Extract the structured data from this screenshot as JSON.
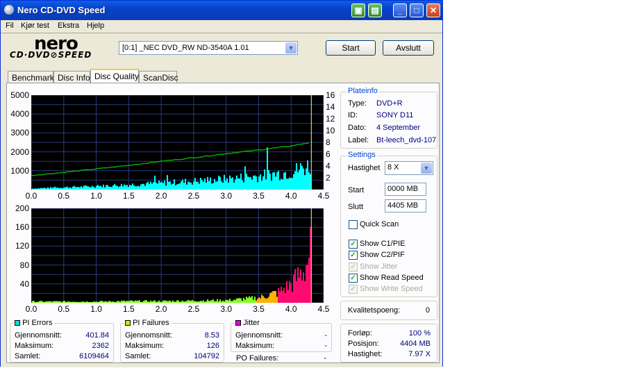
{
  "window": {
    "title": "Nero CD-DVD Speed"
  },
  "menu": [
    "Fil",
    "Kjør test",
    "Ekstra",
    "Hjelp"
  ],
  "logo": {
    "brand": "nero",
    "product": "CD·DVD⊘SPEED"
  },
  "drive": {
    "selected": "[0:1]  _NEC DVD_RW ND-3540A 1.01"
  },
  "buttons": {
    "start": "Start",
    "exit": "Avslutt"
  },
  "tabs": [
    "Benchmark",
    "Disc Info",
    "Disc Quality",
    "ScanDisc"
  ],
  "active_tab": "Disc Quality",
  "plateinfo": {
    "title": "Plateinfo",
    "rows": [
      {
        "label": "Type:",
        "value": "DVD+R"
      },
      {
        "label": "ID:",
        "value": "SONY D11"
      },
      {
        "label": "Dato:",
        "value": "4 September"
      },
      {
        "label": "Label:",
        "value": "Bt-leech_dvd-107"
      }
    ]
  },
  "settings": {
    "title": "Settings",
    "speed_label": "Hastighet",
    "speed_value": "8 X",
    "start_label": "Start",
    "start_value": "0000 MB",
    "end_label": "Slutt",
    "end_value": "4405 MB",
    "checks": [
      {
        "label": "Quick Scan",
        "checked": false,
        "enabled": true
      },
      {
        "label": "Show C1/PIE",
        "checked": true,
        "enabled": true
      },
      {
        "label": "Show C2/PIF",
        "checked": true,
        "enabled": true
      },
      {
        "label": "Show Jitter",
        "checked": true,
        "enabled": false
      },
      {
        "label": "Show Read Speed",
        "checked": true,
        "enabled": true
      },
      {
        "label": "Show Write Speed",
        "checked": true,
        "enabled": false
      }
    ]
  },
  "quality": {
    "label": "Kvalitetspoeng:",
    "value": "0"
  },
  "progress": {
    "rows": [
      {
        "label": "Forløp:",
        "value": "100 %"
      },
      {
        "label": "Posisjon:",
        "value": "4404 MB"
      },
      {
        "label": "Hastighet:",
        "value": "7.97 X"
      }
    ]
  },
  "pi_errors": {
    "title": "PI Errors",
    "color": "#00e0e0",
    "rows": [
      {
        "label": "Gjennomsnitt:",
        "value": "401.84"
      },
      {
        "label": "Maksimum:",
        "value": "2362"
      },
      {
        "label": "Samlet:",
        "value": "6109464"
      }
    ]
  },
  "pi_failures": {
    "title": "PI Failures",
    "color": "#e0e000",
    "rows": [
      {
        "label": "Gjennomsnitt:",
        "value": "8.53"
      },
      {
        "label": "Maksimum:",
        "value": "126"
      },
      {
        "label": "Samlet:",
        "value": "104792"
      }
    ]
  },
  "jitter": {
    "title": "Jitter",
    "color": "#e000e0",
    "rows": [
      {
        "label": "Gjennomsnitt:",
        "value": "-"
      },
      {
        "label": "Maksimum:",
        "value": "-"
      }
    ],
    "po_label": "PO Failures:",
    "po_value": "-"
  },
  "chart_data": [
    {
      "type": "area",
      "series": [
        {
          "name": "PI Errors",
          "color": "#00ffff"
        },
        {
          "name": "Read Speed",
          "color": "#00c000"
        }
      ],
      "x": [
        0.0,
        0.5,
        1.0,
        1.5,
        2.0,
        2.5,
        3.0,
        3.5,
        4.0,
        4.3
      ],
      "pie_values": [
        60,
        120,
        180,
        260,
        340,
        450,
        560,
        720,
        950,
        1300
      ],
      "speed_values": [
        2.4,
        2.9,
        3.5,
        4.1,
        4.8,
        5.4,
        6.1,
        6.7,
        7.4,
        8.0
      ],
      "xlim": [
        0,
        4.5
      ],
      "ylim": [
        0,
        5000
      ],
      "y2lim": [
        0,
        16
      ],
      "xticks": [
        "0.0",
        "0.5",
        "1.0",
        "1.5",
        "2.0",
        "2.5",
        "3.0",
        "3.5",
        "4.0",
        "4.5"
      ],
      "yticks": [
        "1000",
        "2000",
        "3000",
        "4000",
        "5000"
      ],
      "y2ticks": [
        "2",
        "4",
        "6",
        "8",
        "10",
        "12",
        "14",
        "16"
      ],
      "grid": true
    },
    {
      "type": "bar",
      "series": [
        {
          "name": "PI Failures",
          "color": "#ff0080"
        }
      ],
      "x": [
        0.0,
        0.5,
        1.0,
        1.5,
        2.0,
        2.5,
        3.0,
        3.5,
        3.8,
        4.0,
        4.2,
        4.3
      ],
      "pif_values": [
        3,
        3,
        3,
        4,
        4,
        5,
        6,
        12,
        25,
        45,
        80,
        126
      ],
      "xlim": [
        0,
        4.5
      ],
      "ylim": [
        0,
        200
      ],
      "xticks": [
        "0.0",
        "0.5",
        "1.0",
        "1.5",
        "2.0",
        "2.5",
        "3.0",
        "3.5",
        "4.0",
        "4.5"
      ],
      "yticks": [
        "40",
        "80",
        "120",
        "160",
        "200"
      ],
      "grid": true
    }
  ]
}
